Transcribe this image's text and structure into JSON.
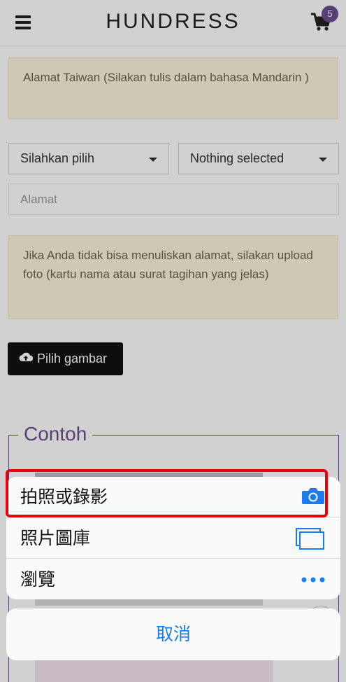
{
  "header": {
    "brand": "HUNDRESS",
    "cart_count": "5"
  },
  "form": {
    "note_taiwan": "Alamat Taiwan (Silakan tulis dalam bahasa Mandarin )",
    "select_region": "Silahkan pilih",
    "select_district": "Nothing selected",
    "address_placeholder": "Alamat",
    "note_upload": "Jika Anda tidak bisa menuliskan alamat, silakan upload foto (kartu nama atau surat tagihan yang jelas)",
    "upload_button": "Pilih gambar",
    "example_legend": "Contoh"
  },
  "action_sheet": {
    "items": [
      {
        "label": "拍照或錄影",
        "icon": "camera-icon"
      },
      {
        "label": "照片圖庫",
        "icon": "photo-library-icon"
      },
      {
        "label": "瀏覽",
        "icon": "more-icon"
      }
    ],
    "cancel": "取消"
  },
  "colors": {
    "brand_purple": "#6b4f8f",
    "ios_blue": "#1a7cf2",
    "highlight_red": "#e8000b",
    "note_bg": "#fcf6dc"
  }
}
